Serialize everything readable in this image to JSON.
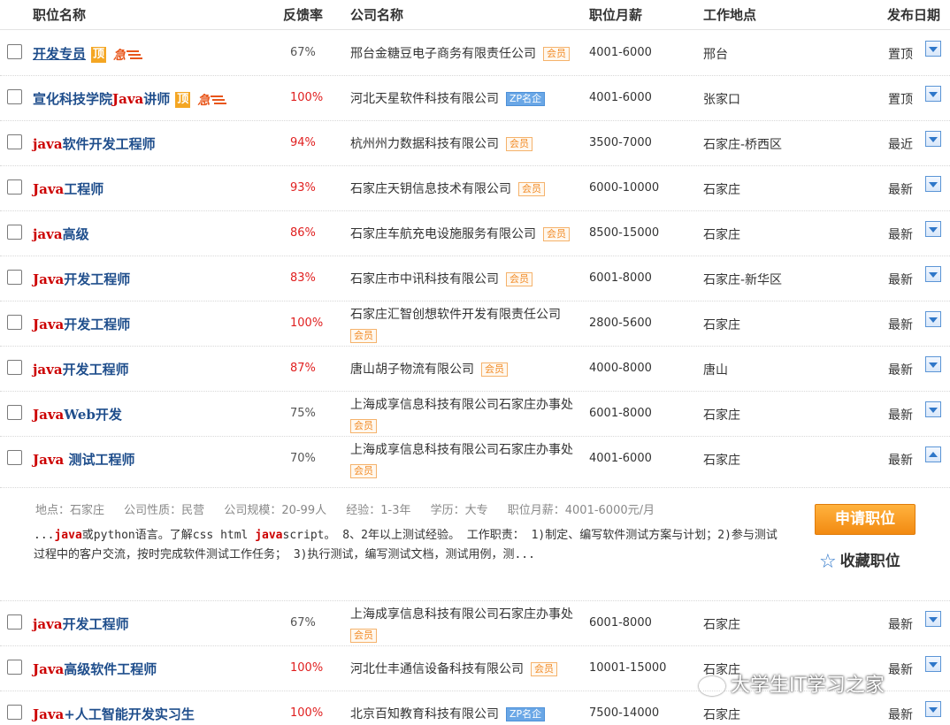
{
  "header": {
    "title": "职位名称",
    "rate": "反馈率",
    "company": "公司名称",
    "salary": "职位月薪",
    "location": "工作地点",
    "date": "发布日期"
  },
  "jobs": [
    {
      "kw": "",
      "rest": "开发专员",
      "top": "顶",
      "urgent": "急",
      "rate": "67%",
      "company": "邢台金糖豆电子商务有限责任公司",
      "badge": "会员",
      "salary": "4001-6000",
      "location": "邢台",
      "date": "置顶"
    },
    {
      "kw": "",
      "rest": "宣化科技学院",
      "kw2": "Java",
      "rest2": "讲师",
      "top": "顶",
      "urgent": "急",
      "rate": "100%",
      "company": "河北天星软件科技有限公司",
      "badge": "ZP名企",
      "salary": "4001-6000",
      "location": "张家口",
      "date": "置顶"
    },
    {
      "kw": "java",
      "rest": "软件开发工程师",
      "rate": "94%",
      "company": "杭州州力数据科技有限公司",
      "badge": "会员",
      "salary": "3500-7000",
      "location": "石家庄-桥西区",
      "date": "最近"
    },
    {
      "kw": "Java",
      "rest": "工程师",
      "rate": "93%",
      "company": "石家庄天钥信息技术有限公司",
      "badge": "会员",
      "salary": "6000-10000",
      "location": "石家庄",
      "date": "最新"
    },
    {
      "kw": "java",
      "rest": "高级",
      "rate": "86%",
      "company": "石家庄车航充电设施服务有限公司",
      "badge": "会员",
      "salary": "8500-15000",
      "location": "石家庄",
      "date": "最新"
    },
    {
      "kw": "Java",
      "rest": "开发工程师",
      "rate": "83%",
      "company": "石家庄市中讯科技有限公司",
      "badge": "会员",
      "salary": "6001-8000",
      "location": "石家庄-新华区",
      "date": "最新"
    },
    {
      "kw": "Java",
      "rest": "开发工程师",
      "rate": "100%",
      "company": "石家庄汇智创想软件开发有限责任公司",
      "badge": "会员",
      "salary": "2800-5600",
      "location": "石家庄",
      "date": "最新"
    },
    {
      "kw": "java",
      "rest": "开发工程师",
      "rate": "87%",
      "company": "唐山胡子物流有限公司",
      "badge": "会员",
      "salary": "4000-8000",
      "location": "唐山",
      "date": "最新"
    },
    {
      "kw": "Java",
      "rest": "Web开发",
      "rate": "75%",
      "company": "上海成享信息科技有限公司石家庄办事处",
      "badge": "会员",
      "salary": "6001-8000",
      "location": "石家庄",
      "date": "最新"
    },
    {
      "kw": "Java",
      "rest": " 测试工程师",
      "rate": "70%",
      "company": "上海成享信息科技有限公司石家庄办事处",
      "badge": "会员",
      "salary": "4001-6000",
      "location": "石家庄",
      "date": "最新"
    },
    {
      "kw": "java",
      "rest": "开发工程师",
      "rate": "67%",
      "company": "上海成享信息科技有限公司石家庄办事处",
      "badge": "会员",
      "salary": "6001-8000",
      "location": "石家庄",
      "date": "最新"
    },
    {
      "kw": "Java",
      "rest": "高级软件工程师",
      "rate": "100%",
      "company": "河北仕丰通信设备科技有限公司",
      "badge": "会员",
      "salary": "10001-15000",
      "location": "石家庄",
      "date": "最新"
    },
    {
      "kw": "Java",
      "rest": "+人工智能开发实习生",
      "rate": "100%",
      "company": "北京百知教育科技有限公司",
      "badge": "ZP名企",
      "salary": "7500-14000",
      "location": "石家庄",
      "date": "最新"
    }
  ],
  "detail": {
    "place": "地点：石家庄",
    "nature": "公司性质：民营",
    "scale": "公司规模：20-99人",
    "exp": "经验：1-3年",
    "edu": "学历：大专",
    "salary": "职位月薪：4001-6000元/月",
    "d1": "...",
    "d2": "java",
    "d3": "或python语言。了解css html ",
    "d4": "java",
    "d5": "script。 8、2年以上测试经验。 工作职责： 1)制定、编写软件测试方案与计划；2)参与测试过程中的客户交流，按时完成软件测试工作任务； 3)执行测试，编写测试文档，测试用例，测...",
    "apply": "申请职位",
    "favorite": "收藏职位"
  },
  "watermark": "大学生IT学习之家",
  "icons": {
    "expand": "chevron-down-icon",
    "collapse": "chevron-up-icon",
    "favorite": "star-icon"
  },
  "colors": {
    "title": "#1f4e8c",
    "keyword": "#cc0000",
    "rate_high": "#e02020",
    "accent": "#f28a11"
  }
}
